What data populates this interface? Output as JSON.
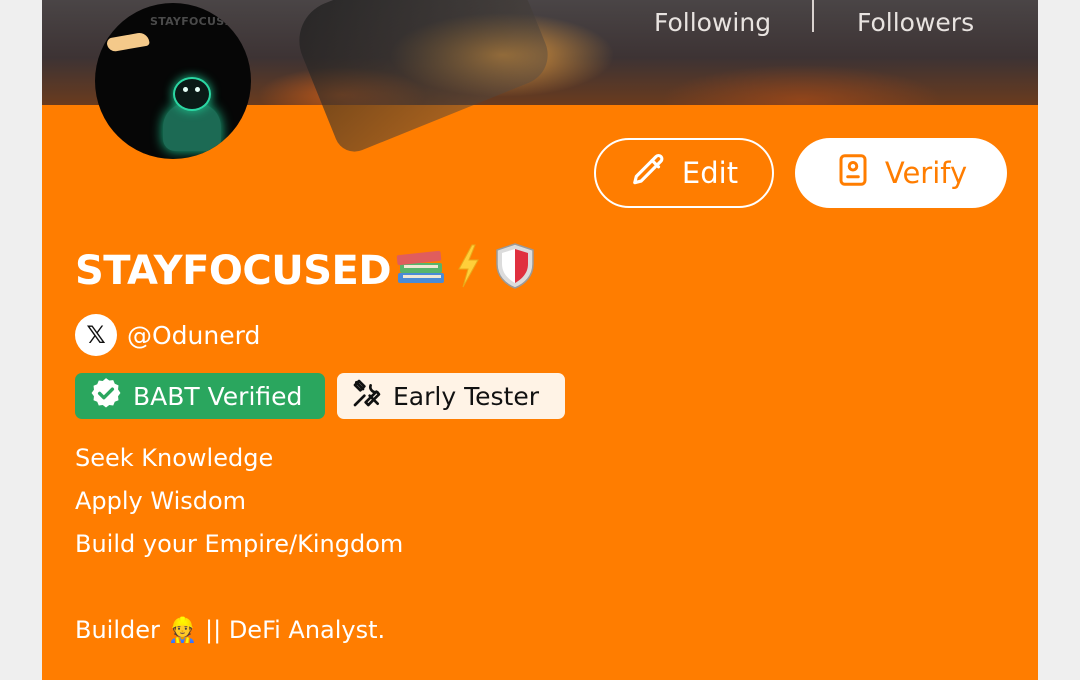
{
  "profile": {
    "banner_stats": {
      "following_label": "Following",
      "followers_label": "Followers"
    },
    "avatar_text": "STAYFOCUSED",
    "actions": {
      "edit_label": "Edit",
      "verify_label": "Verify"
    },
    "display_name": "STAYFOCUSED",
    "handle": "@Odunerd",
    "social_icon_text": "𝕏",
    "badges": [
      {
        "label": "BABT Verified",
        "icon": "verified-check-icon"
      },
      {
        "label": "Early Tester",
        "icon": "tools-icon"
      }
    ],
    "bio_lines": [
      "Seek Knowledge",
      "Apply Wisdom",
      "Build your Empire/Kingdom",
      "",
      "Builder 👷 || DeFi Analyst."
    ]
  },
  "colors": {
    "accent_orange": "#ff7d00",
    "badge_green": "#2aa65e",
    "badge_cream": "#fff3e6"
  }
}
